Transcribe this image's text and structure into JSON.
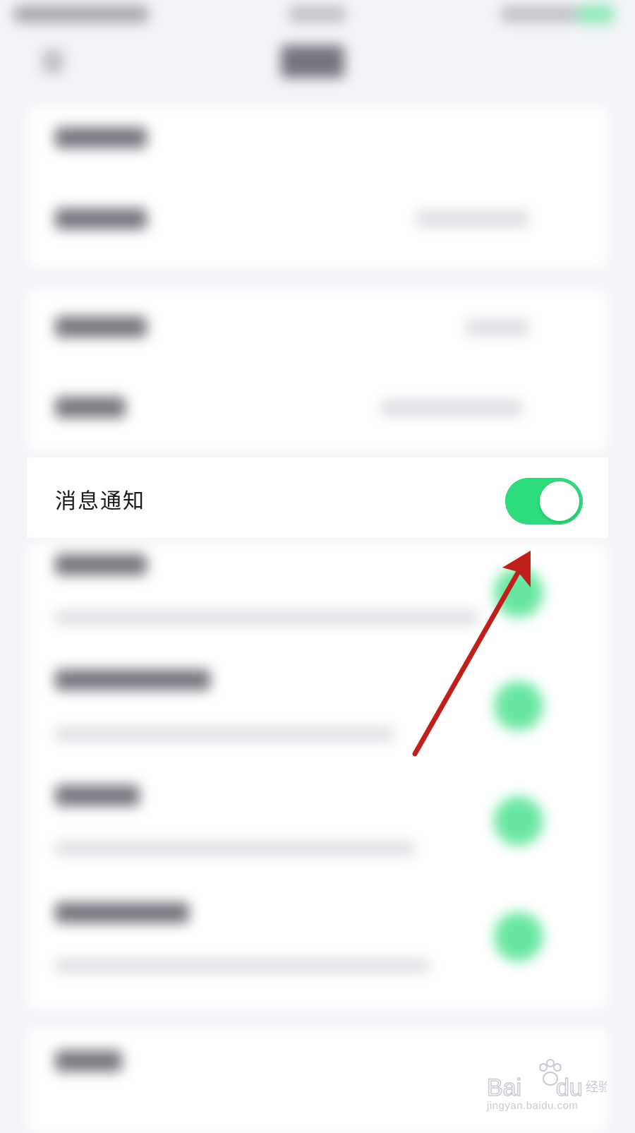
{
  "settings": {
    "focused_row": {
      "label": "消息通知",
      "toggle_on": true
    }
  },
  "colors": {
    "toggle_on": "#2ddc7a",
    "arrow": "#c0201c",
    "background": "#f3f4f8"
  },
  "annotation": {
    "type": "arrow",
    "points_to": "message-notification-toggle"
  },
  "watermark": {
    "logo_text": "Baidu经验",
    "url_text": "jingyan.baidu.com"
  }
}
